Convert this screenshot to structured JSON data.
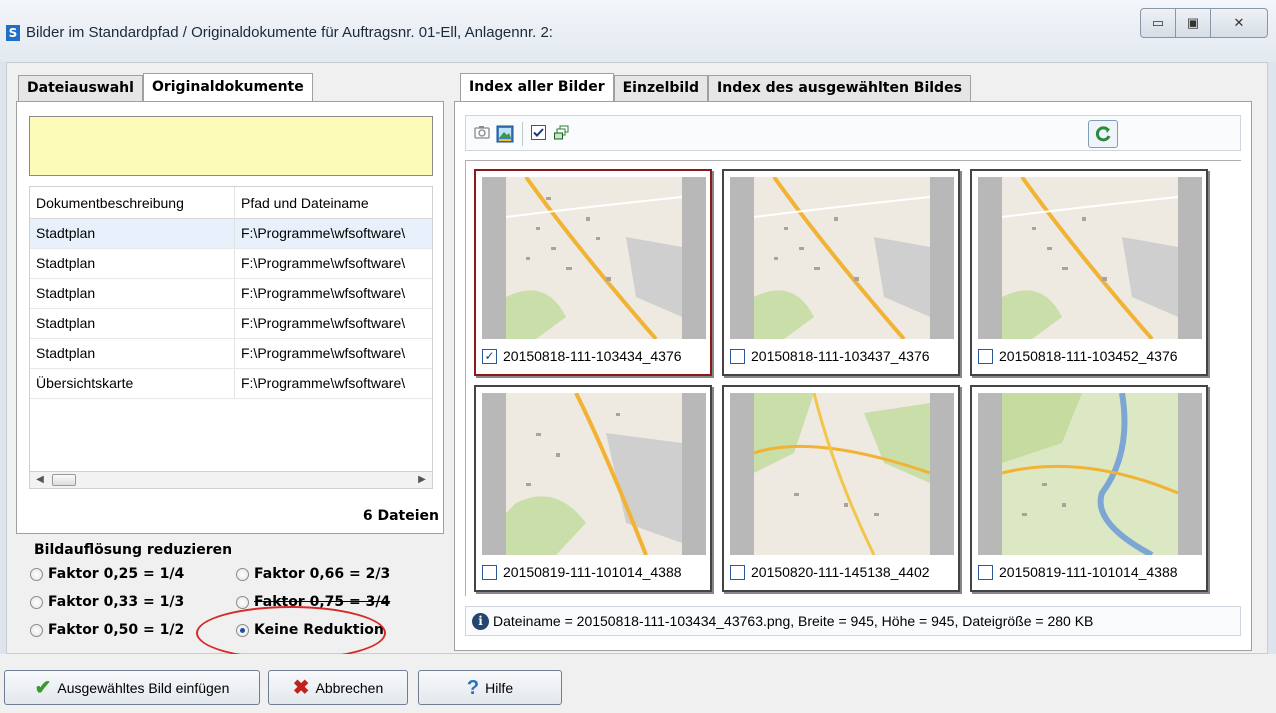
{
  "window": {
    "title": "Bilder im Standardpfad / Originaldokumente für Auftragsnr. 01-Ell, Anlagennr. 2:",
    "app_icon": "S",
    "min_glyph": "▭",
    "max_glyph": "▣",
    "close_glyph": "✕"
  },
  "left_tabs": [
    {
      "label": "Dateiauswahl",
      "active": false
    },
    {
      "label": "Originaldokumente",
      "active": true
    }
  ],
  "documents": {
    "columns": [
      "Dokumentbeschreibung",
      "Pfad und Dateiname"
    ],
    "rows": [
      {
        "desc": "Stadtplan",
        "path": "F:\\Programme\\wfsoftware\\"
      },
      {
        "desc": "Stadtplan",
        "path": "F:\\Programme\\wfsoftware\\"
      },
      {
        "desc": "Stadtplan",
        "path": "F:\\Programme\\wfsoftware\\"
      },
      {
        "desc": "Stadtplan",
        "path": "F:\\Programme\\wfsoftware\\"
      },
      {
        "desc": "Stadtplan",
        "path": "F:\\Programme\\wfsoftware\\"
      },
      {
        "desc": "Übersichtskarte",
        "path": "F:\\Programme\\wfsoftware\\"
      }
    ],
    "count_label": "6 Dateien"
  },
  "reduction": {
    "title": "Bildauflösung reduzieren",
    "options": [
      {
        "label": "Faktor 0,25 = 1/4",
        "checked": false
      },
      {
        "label": "Faktor 0,33 = 1/3",
        "checked": false
      },
      {
        "label": "Faktor 0,50 = 1/2",
        "checked": false
      },
      {
        "label": "Faktor 0,66 = 2/3",
        "checked": false
      },
      {
        "label": "Faktor 0,75 = 3/4",
        "checked": false
      },
      {
        "label": "Keine Reduktion",
        "checked": true
      }
    ]
  },
  "right_tabs": [
    {
      "label": "Index aller Bilder",
      "active": true
    },
    {
      "label": "Einzelbild",
      "active": false
    },
    {
      "label": "Index des ausgewählten Bildes",
      "active": false
    }
  ],
  "toolbar": {
    "icons": [
      "camera-icon",
      "image-frame-icon",
      "checkbox-icon",
      "thumbnails-icon",
      "refresh-icon"
    ]
  },
  "thumbnails": [
    {
      "label": "20150818-111-103434_4376",
      "checked": true,
      "selected": true
    },
    {
      "label": "20150818-111-103437_4376",
      "checked": false,
      "selected": false
    },
    {
      "label": "20150818-111-103452_4376",
      "checked": false,
      "selected": false
    },
    {
      "label": "20150819-111-101014_4388",
      "checked": false,
      "selected": false
    },
    {
      "label": "20150820-111-145138_4402",
      "checked": false,
      "selected": false
    },
    {
      "label": "20150819-111-101014_4388",
      "checked": false,
      "selected": false
    }
  ],
  "status": {
    "text": "Dateiname = 20150818-111-103434_43763.png, Breite = 945, Höhe = 945, Dateigröße = 280 KB"
  },
  "buttons": {
    "insert": "Ausgewähltes Bild einfügen",
    "cancel": "Abbrechen",
    "help": "Hilfe"
  },
  "colors": {
    "accent_yellow": "#fdfbb8",
    "selected_border": "#8a1a1a",
    "highlight_ellipse": "#d62a2a"
  }
}
